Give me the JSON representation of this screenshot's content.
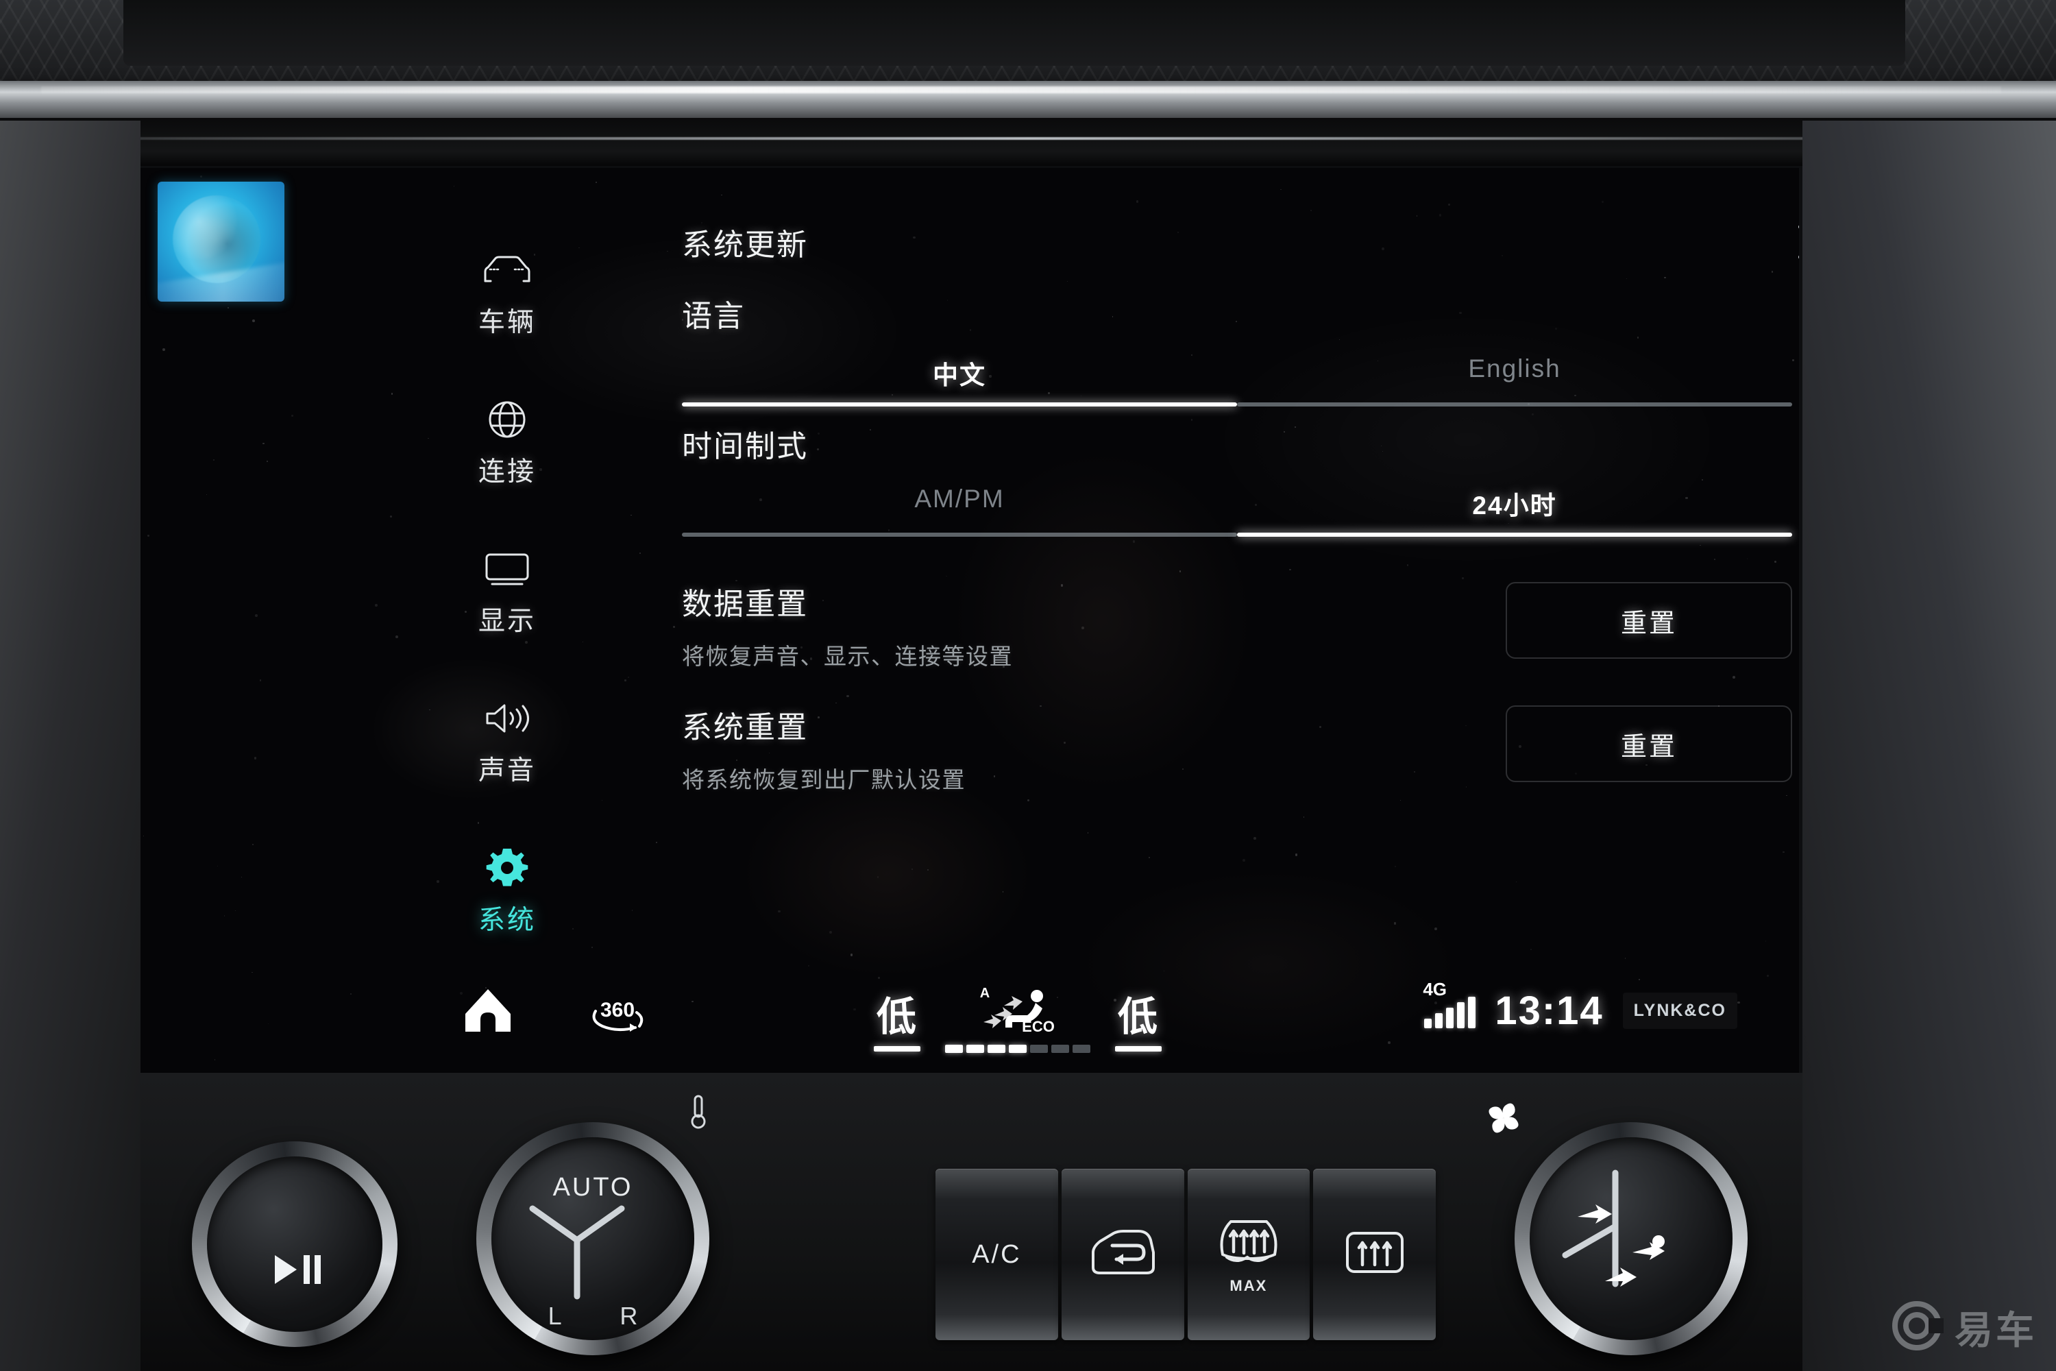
{
  "screen": {
    "sticker": {
      "name": "blue-moon-sticker"
    },
    "sidebar": {
      "items": [
        {
          "label": "车辆",
          "icon": "car-icon",
          "active": false
        },
        {
          "label": "连接",
          "icon": "globe-icon",
          "active": false
        },
        {
          "label": "显示",
          "icon": "monitor-icon",
          "active": false
        },
        {
          "label": "声音",
          "icon": "speaker-icon",
          "active": false
        },
        {
          "label": "系统",
          "icon": "gear-icon",
          "active": true
        }
      ],
      "active_color": "#46e6de"
    },
    "settings": {
      "system_update": {
        "title": "系统更新",
        "chevron": "chevron-right-icon"
      },
      "language": {
        "title": "语言",
        "options": [
          {
            "label": "中文",
            "selected": true
          },
          {
            "label": "English",
            "selected": false
          }
        ]
      },
      "time_format": {
        "title": "时间制式",
        "options": [
          {
            "label": "AM/PM",
            "selected": false
          },
          {
            "label": "24小时",
            "selected": true
          }
        ]
      },
      "data_reset": {
        "title": "数据重置",
        "subtitle": "将恢复声音、显示、连接等设置",
        "button": "重置"
      },
      "system_reset": {
        "title": "系统重置",
        "subtitle": "将系统恢复到出厂默认设置",
        "button": "重置"
      }
    },
    "statusbar": {
      "home_icon": "home-icon",
      "camera_360": "360-camera-icon",
      "temp_left": "低",
      "temp_right": "低",
      "airflow_icon": "auto-eco-airflow-icon",
      "eco_label": "ECO",
      "auto_label": "A",
      "fan_segments_total": 7,
      "fan_segments_on": 4,
      "network": "4G",
      "signal_bars_total": 5,
      "signal_bars_on": 5,
      "clock": "13:14",
      "brand": "LYNK&CO"
    }
  },
  "console": {
    "media_knob": {
      "icon": "play-pause-icon"
    },
    "auto_knob": {
      "label": "AUTO",
      "lr_label": "L R",
      "temp_icon": "thermometer-icon"
    },
    "fan_knob": {
      "icon": "fan-icon"
    },
    "buttons": [
      {
        "label": "A/C",
        "icon": "ac-text",
        "sub": ""
      },
      {
        "label": "",
        "icon": "recirculation-icon",
        "sub": ""
      },
      {
        "label": "",
        "icon": "front-defrost-icon",
        "sub": "MAX"
      },
      {
        "label": "",
        "icon": "rear-defrost-icon",
        "sub": ""
      }
    ]
  },
  "watermark": {
    "text": "易车",
    "icon": "yiche-logo-icon"
  }
}
